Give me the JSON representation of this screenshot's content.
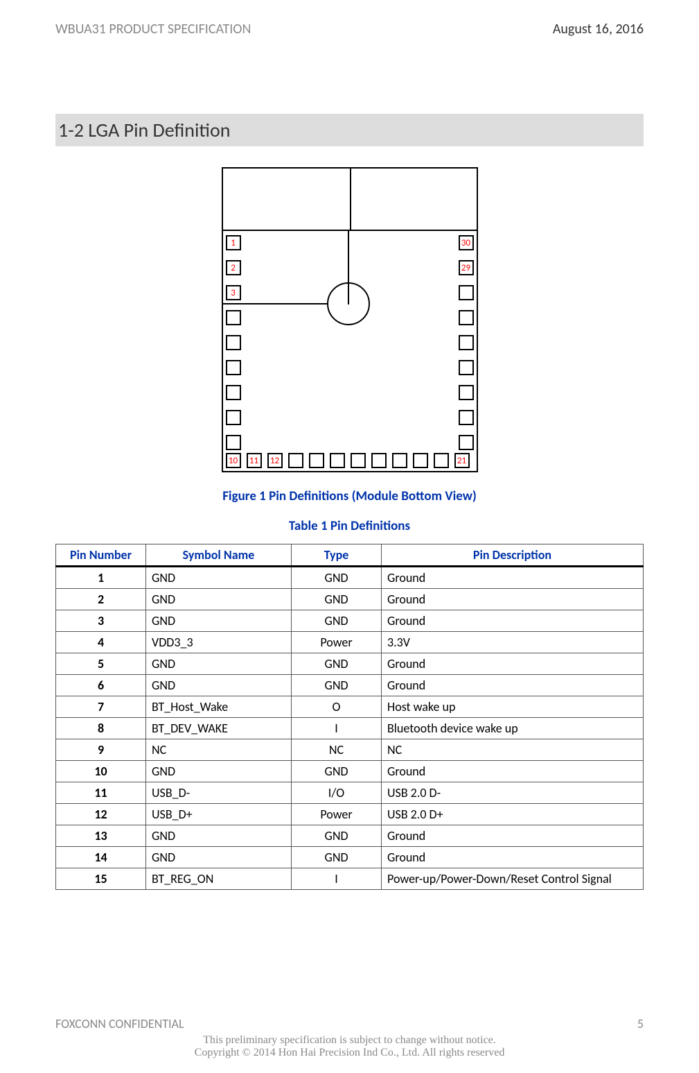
{
  "header": {
    "left": "WBUA31 PRODUCT SPECIFICATION",
    "right": "August 16, 2016"
  },
  "section_title": "1-2    LGA Pin Definition",
  "figure_caption": "Figure 1 Pin Definitions (Module Bottom View)",
  "table_caption": "Table 1 Pin Definitions",
  "pins_diagram": {
    "left_labels": [
      "1",
      "2",
      "3",
      "",
      "",
      "",
      "",
      "",
      ""
    ],
    "right_labels": [
      "30",
      "29",
      "",
      "",
      "",
      "",
      "",
      "",
      ""
    ],
    "bottom_labels": [
      "10",
      "11",
      "12",
      "",
      "",
      "",
      "",
      "",
      "",
      "",
      "",
      "21"
    ]
  },
  "table": {
    "headers": [
      "Pin Number",
      "Symbol Name",
      "Type",
      "Pin Description"
    ],
    "rows": [
      {
        "num": "1",
        "sym": "GND",
        "type": "GND",
        "desc": "Ground"
      },
      {
        "num": "2",
        "sym": "GND",
        "type": "GND",
        "desc": "Ground"
      },
      {
        "num": "3",
        "sym": "GND",
        "type": "GND",
        "desc": "Ground"
      },
      {
        "num": "4",
        "sym": "VDD3_3",
        "type": "Power",
        "desc": "3.3V"
      },
      {
        "num": "5",
        "sym": "GND",
        "type": "GND",
        "desc": "Ground"
      },
      {
        "num": "6",
        "sym": "GND",
        "type": "GND",
        "desc": "Ground"
      },
      {
        "num": "7",
        "sym": "BT_Host_Wake",
        "type": "O",
        "desc": "Host wake up"
      },
      {
        "num": "8",
        "sym": "BT_DEV_WAKE",
        "type": "I",
        "desc": "Bluetooth device wake up"
      },
      {
        "num": "9",
        "sym": "NC",
        "type": "NC",
        "desc": "NC"
      },
      {
        "num": "10",
        "sym": "GND",
        "type": "GND",
        "desc": "Ground"
      },
      {
        "num": "11",
        "sym": "USB_D-",
        "type": "I/O",
        "desc": "USB 2.0 D-"
      },
      {
        "num": "12",
        "sym": "USB_D+",
        "type": "Power",
        "desc": "USB 2.0 D+"
      },
      {
        "num": "13",
        "sym": "GND",
        "type": "GND",
        "desc": "Ground"
      },
      {
        "num": "14",
        "sym": "GND",
        "type": "GND",
        "desc": "Ground"
      },
      {
        "num": "15",
        "sym": "BT_REG_ON",
        "type": "I",
        "desc": "Power-up/Power-Down/Reset Control Signal"
      }
    ]
  },
  "footer": {
    "left": "FOXCONN CONFIDENTIAL",
    "page": "5",
    "line1": "This preliminary specification is subject to change without notice.",
    "line2": "Copyright © 2014 Hon Hai Precision Ind Co., Ltd. All rights reserved"
  }
}
